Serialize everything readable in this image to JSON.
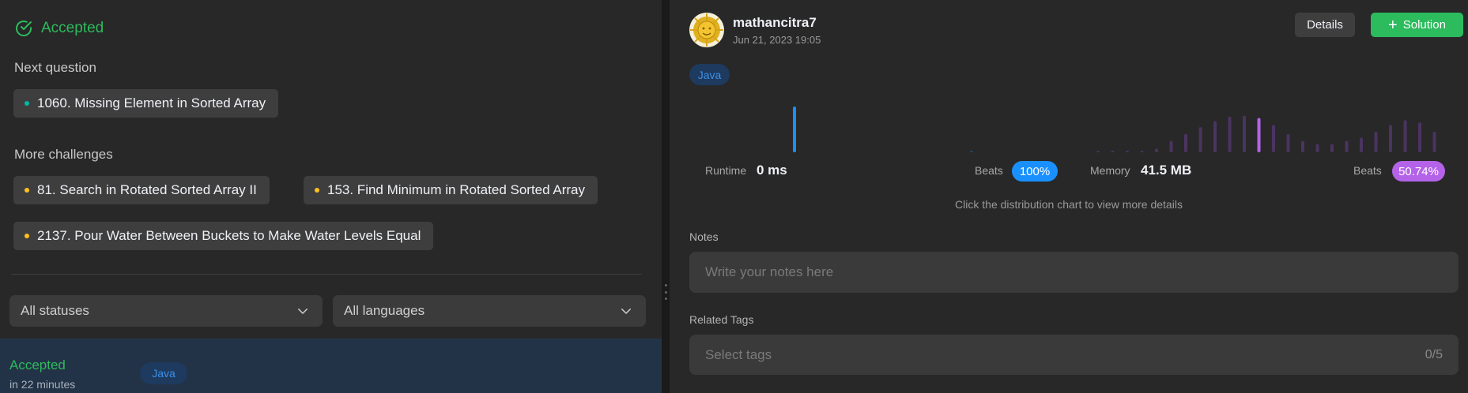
{
  "left": {
    "status": "Accepted",
    "next_question_label": "Next question",
    "next_question": {
      "title": "1060. Missing Element in Sorted Array",
      "dot_color": "#00b8a3"
    },
    "more_challenges_label": "More challenges",
    "challenges": [
      {
        "title": "81. Search in Rotated Sorted Array II",
        "dot_color": "#ffc01e"
      },
      {
        "title": "153. Find Minimum in Rotated Sorted Array",
        "dot_color": "#ffc01e"
      },
      {
        "title": "2137. Pour Water Between Buckets to Make Water Levels Equal",
        "dot_color": "#ffc01e"
      }
    ],
    "filters": {
      "status": "All statuses",
      "language": "All languages"
    },
    "submission": {
      "status": "Accepted",
      "time": "in 22 minutes",
      "language": "Java"
    }
  },
  "right": {
    "username": "mathancitra7",
    "timestamp": "Jun 21, 2023 19:05",
    "details_label": "Details",
    "solution_label": "Solution",
    "language": "Java",
    "runtime": {
      "label": "Runtime",
      "value": "0 ms",
      "beats_label": "Beats",
      "beats": "100%",
      "color": "#1a90ff"
    },
    "memory": {
      "label": "Memory",
      "value": "41.5 MB",
      "beats_label": "Beats",
      "beats": "50.74%",
      "color": "#b463e8"
    },
    "hint": "Click the distribution chart to view more details",
    "notes_label": "Notes",
    "notes_placeholder": "Write your notes here",
    "tags_label": "Related Tags",
    "tags_placeholder": "Select tags",
    "tags_count": "0/5",
    "runtime_distribution": [
      1.0,
      0.03
    ],
    "memory_distribution": [
      0.03,
      0.03,
      0.03,
      0.03,
      0.08,
      0.25,
      0.4,
      0.55,
      0.68,
      0.78,
      0.8,
      0.75,
      0.6,
      0.4,
      0.25,
      0.18,
      0.18,
      0.25,
      0.32,
      0.45,
      0.6,
      0.7,
      0.65,
      0.45
    ]
  }
}
